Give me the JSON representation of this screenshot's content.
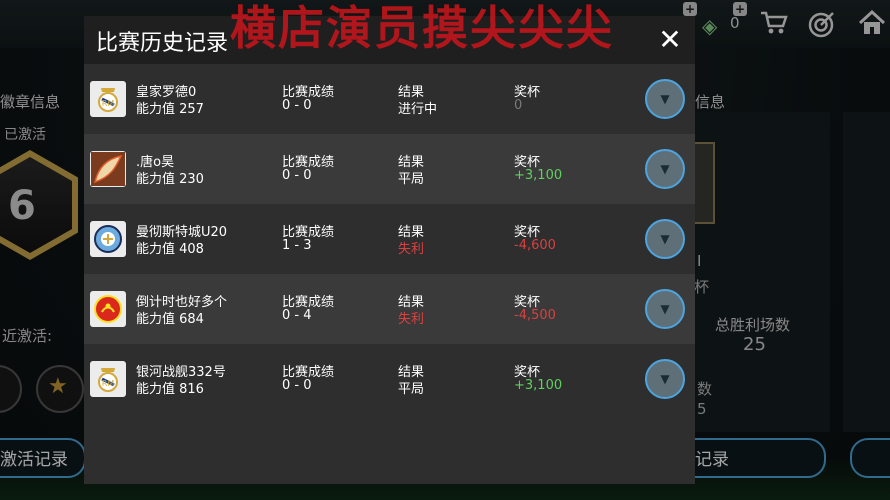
{
  "watermark": {
    "text": "横店演员摸尖尖尖"
  },
  "topbar": {
    "coin_count": "0",
    "icons": [
      "diamond-icon",
      "cart-icon",
      "target-icon",
      "home-icon"
    ]
  },
  "left_panel": {
    "title": "徽章信息",
    "active_label": "已激活",
    "badge_number": "6",
    "recent_label": "近激活:",
    "button_label": "激活记录"
  },
  "right_panel": {
    "title": "信息",
    "cup_label": "杯",
    "stat_label": "总胜利场数",
    "stat_value": "25",
    "stat_label2": "数",
    "stat_value2": "5",
    "button_label": "记录"
  },
  "modal": {
    "title": "比赛历史记录",
    "close_label": "✕",
    "column_headers": {
      "score": "比赛成绩",
      "result": "结果",
      "trophy": "奖杯"
    },
    "rows": [
      {
        "team": "皇家罗德0",
        "power": "能力值 257",
        "score": "0 - 0",
        "result": "进行中",
        "trophy": "0",
        "result_type": "normal",
        "trophy_type": "neutral",
        "crest": "real-madrid-crest-icon"
      },
      {
        "team": ".唐o昊",
        "power": "能力值 230",
        "score": "0 - 0",
        "result": "平局",
        "trophy": "+3,100",
        "result_type": "normal",
        "trophy_type": "win",
        "crest": "wing-crest-icon"
      },
      {
        "team": "曼彻斯特城U20",
        "power": "能力值 408",
        "score": "1 - 3",
        "result": "失利",
        "trophy": "-4,600",
        "result_type": "loss",
        "trophy_type": "loss",
        "crest": "man-city-crest-icon"
      },
      {
        "team": "倒计时也好多个",
        "power": "能力值 684",
        "score": "0 - 4",
        "result": "失利",
        "trophy": "-4,500",
        "result_type": "loss",
        "trophy_type": "loss",
        "crest": "man-utd-crest-icon"
      },
      {
        "team": "银河战舰332号",
        "power": "能力值 816",
        "score": "0 - 0",
        "result": "平局",
        "trophy": "+3,100",
        "result_type": "normal",
        "trophy_type": "win",
        "crest": "real-madrid-crest-icon"
      }
    ]
  },
  "colors": {
    "win": "#5ed15e",
    "loss": "#d94040",
    "neutral": "#7a7a7a",
    "accent": "#4da4de",
    "watermark": "#c0161b"
  }
}
